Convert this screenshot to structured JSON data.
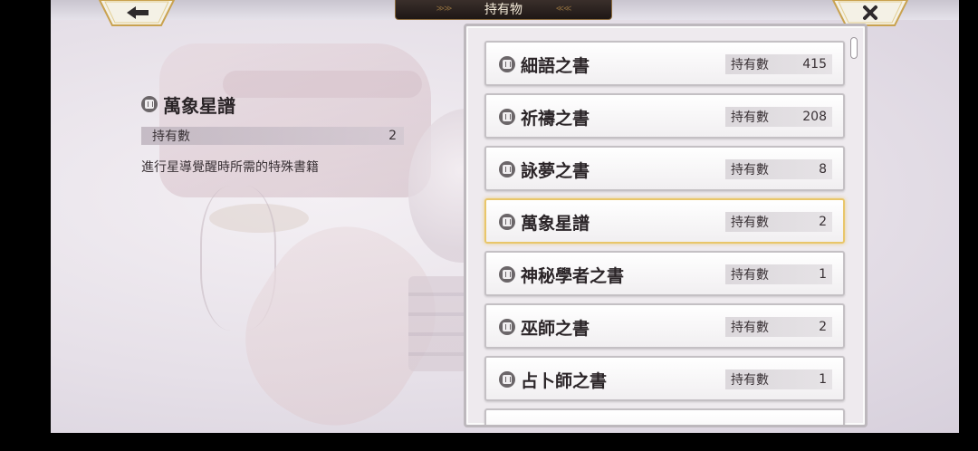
{
  "header": {
    "title": "持有物",
    "back_icon": "back-arrow-icon",
    "close_icon": "close-icon"
  },
  "detail": {
    "name": "萬象星譜",
    "count_label": "持有數",
    "count_value": "2",
    "description": "進行星導覺醒時所需的特殊書籍"
  },
  "items": [
    {
      "name": "細語之書",
      "count_label": "持有數",
      "count": "415"
    },
    {
      "name": "祈禱之書",
      "count_label": "持有數",
      "count": "208"
    },
    {
      "name": "詠夢之書",
      "count_label": "持有數",
      "count": "8"
    },
    {
      "name": "萬象星譜",
      "count_label": "持有數",
      "count": "2"
    },
    {
      "name": "神秘學者之書",
      "count_label": "持有數",
      "count": "1"
    },
    {
      "name": "巫師之書",
      "count_label": "持有數",
      "count": "2"
    },
    {
      "name": "占卜師之書",
      "count_label": "持有數",
      "count": "1"
    }
  ],
  "selected_index": 3,
  "colors": {
    "selected_border": "#e9c66a",
    "title_plate": "#1e1715"
  }
}
